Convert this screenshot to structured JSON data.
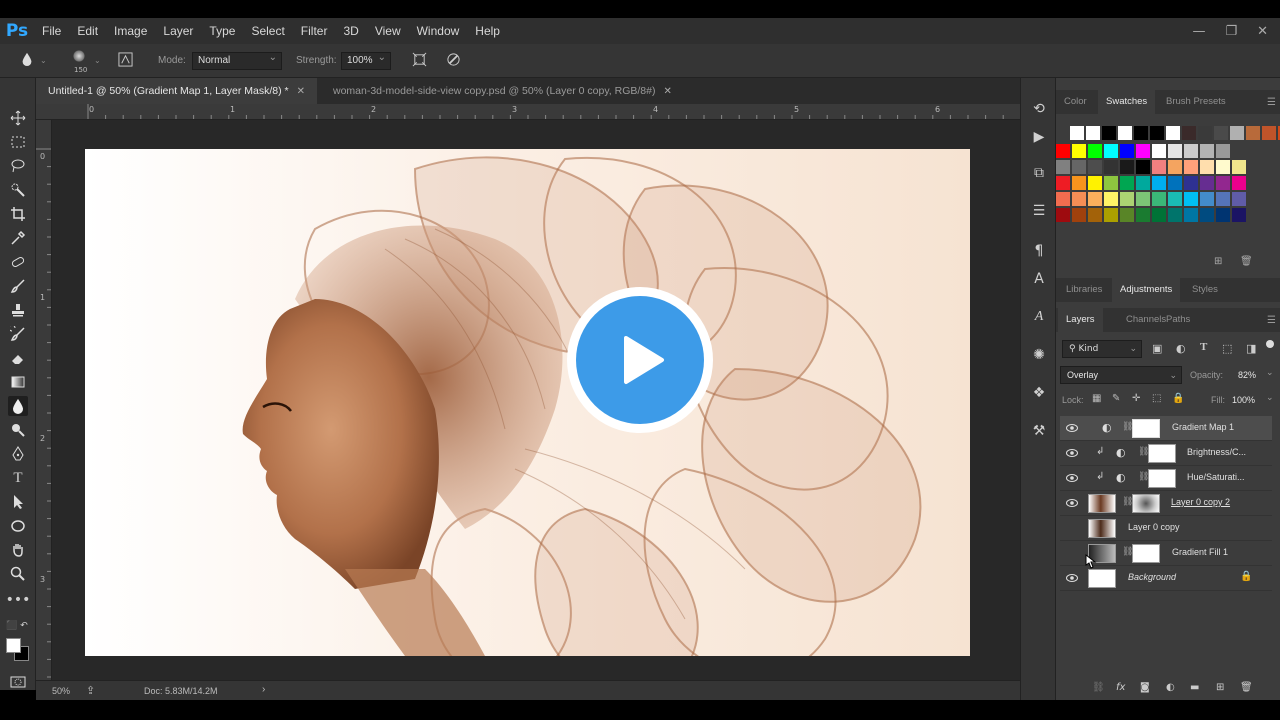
{
  "app": {
    "logo": "Ps"
  },
  "menu": [
    "File",
    "Edit",
    "Image",
    "Layer",
    "Type",
    "Select",
    "Filter",
    "3D",
    "View",
    "Window",
    "Help"
  ],
  "options": {
    "brush_size": "150",
    "mode_label": "Mode:",
    "mode_value": "Normal",
    "strength_label": "Strength:",
    "strength_value": "100%"
  },
  "tabs": [
    {
      "title": "Untitled-1 @ 50% (Gradient Map 1, Layer Mask/8) *",
      "active": true
    },
    {
      "title": "woman-3d-model-side-view copy.psd @ 50% (Layer 0 copy, RGB/8#)",
      "active": false
    }
  ],
  "rulers": {
    "horizontal": [
      "0",
      "1",
      "2",
      "3",
      "4",
      "5",
      "6"
    ],
    "vertical": [
      "0",
      "1",
      "2",
      "3"
    ]
  },
  "status": {
    "zoom": "50%",
    "doc": "Doc: 5.83M/14.2M"
  },
  "swatches_panel": {
    "tabs": [
      "Color",
      "Swatches",
      "Brush Presets"
    ],
    "active": "Swatches"
  },
  "adjustments_panel": {
    "tabs": [
      "Libraries",
      "Adjustments",
      "Styles"
    ],
    "active": "Adjustments"
  },
  "layers_panel": {
    "tabs": [
      "Layers",
      "Channels",
      "Paths"
    ],
    "active": "Layers",
    "filter_label": "Kind",
    "blend_mode": "Overlay",
    "opacity_label": "Opacity:",
    "opacity_value": "82%",
    "lock_label": "Lock:",
    "fill_label": "Fill:",
    "fill_value": "100%",
    "layers": [
      {
        "name": "Gradient Map 1",
        "visible": true,
        "selected": true
      },
      {
        "name": "Brightness/C...",
        "visible": true,
        "selected": false
      },
      {
        "name": "Hue/Saturati...",
        "visible": true,
        "selected": false
      },
      {
        "name": "Layer 0 copy 2",
        "visible": true,
        "selected": false
      },
      {
        "name": "Layer 0 copy",
        "visible": false,
        "selected": false
      },
      {
        "name": "Gradient Fill 1",
        "visible": false,
        "selected": false
      },
      {
        "name": "Background",
        "visible": true,
        "selected": false
      }
    ]
  },
  "colors": {
    "accent": "#31a8ff",
    "play_button": "#3d9be8",
    "sepia": "#a0623c",
    "ui_dark": "#353535"
  }
}
